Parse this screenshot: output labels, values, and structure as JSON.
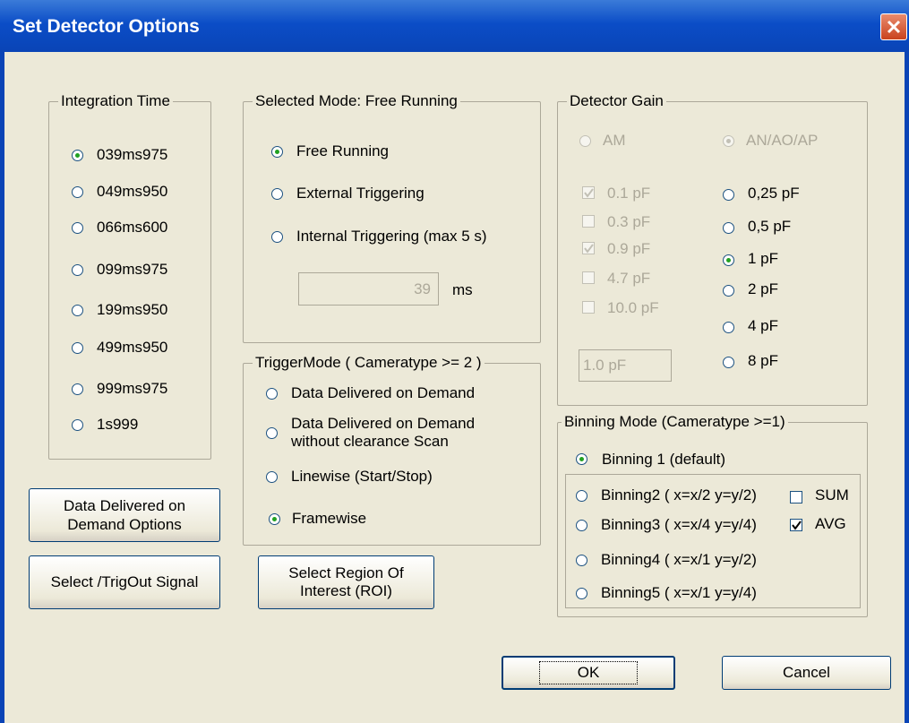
{
  "window": {
    "title": "Set Detector Options"
  },
  "integration_time": {
    "legend": "Integration Time",
    "options": [
      "039ms975",
      "049ms950",
      "066ms600",
      "099ms975",
      "199ms950",
      "499ms950",
      "999ms975",
      "1s999"
    ],
    "selected": "039ms975"
  },
  "selected_mode": {
    "legend": "Selected Mode: Free Running",
    "options": [
      "Free Running",
      "External Triggering",
      "Internal Triggering (max 5 s)"
    ],
    "selected": "Free Running",
    "interval_value": "39",
    "interval_unit": "ms"
  },
  "trigger_mode": {
    "legend": "TriggerMode ( Cameratype >= 2 )",
    "options": [
      "Data Delivered on Demand",
      "Data Delivered on Demand\nwithout clearance Scan",
      "Linewise (Start/Stop)",
      "Framewise"
    ],
    "selected": "Framewise"
  },
  "detector_gain": {
    "legend": "Detector Gain",
    "mode_am": "AM",
    "mode_an": "AN/AO/AP",
    "am_options": [
      {
        "label": "0.1 pF",
        "checked": true
      },
      {
        "label": "0.3 pF",
        "checked": false
      },
      {
        "label": "0.9 pF",
        "checked": true
      },
      {
        "label": "4.7 pF",
        "checked": false
      },
      {
        "label": "10.0 pF",
        "checked": false
      }
    ],
    "an_options": [
      "0,25 pF",
      "0,5 pF",
      "1 pF",
      "2 pF",
      "4 pF",
      "8 pF"
    ],
    "an_selected": "1 pF",
    "gain_value": "1.0 pF"
  },
  "binning_mode": {
    "legend": "Binning Mode (Cameratype >=1)",
    "default_option": "Binning 1 (default)",
    "options": [
      "Binning2 ( x=x/2 y=y/2)",
      "Binning3 ( x=x/4 y=y/4)",
      "Binning4 ( x=x/1 y=y/2)",
      "Binning5 ( x=x/1 y=y/4)"
    ],
    "selected": "Binning 1 (default)",
    "sum_label": "SUM",
    "sum_checked": false,
    "avg_label": "AVG",
    "avg_checked": true
  },
  "buttons": {
    "data_delivered": "Data Delivered on\nDemand Options",
    "trigout": "Select /TrigOut Signal",
    "roi": "Select Region Of\nInterest (ROI)",
    "ok": "OK",
    "cancel": "Cancel"
  }
}
